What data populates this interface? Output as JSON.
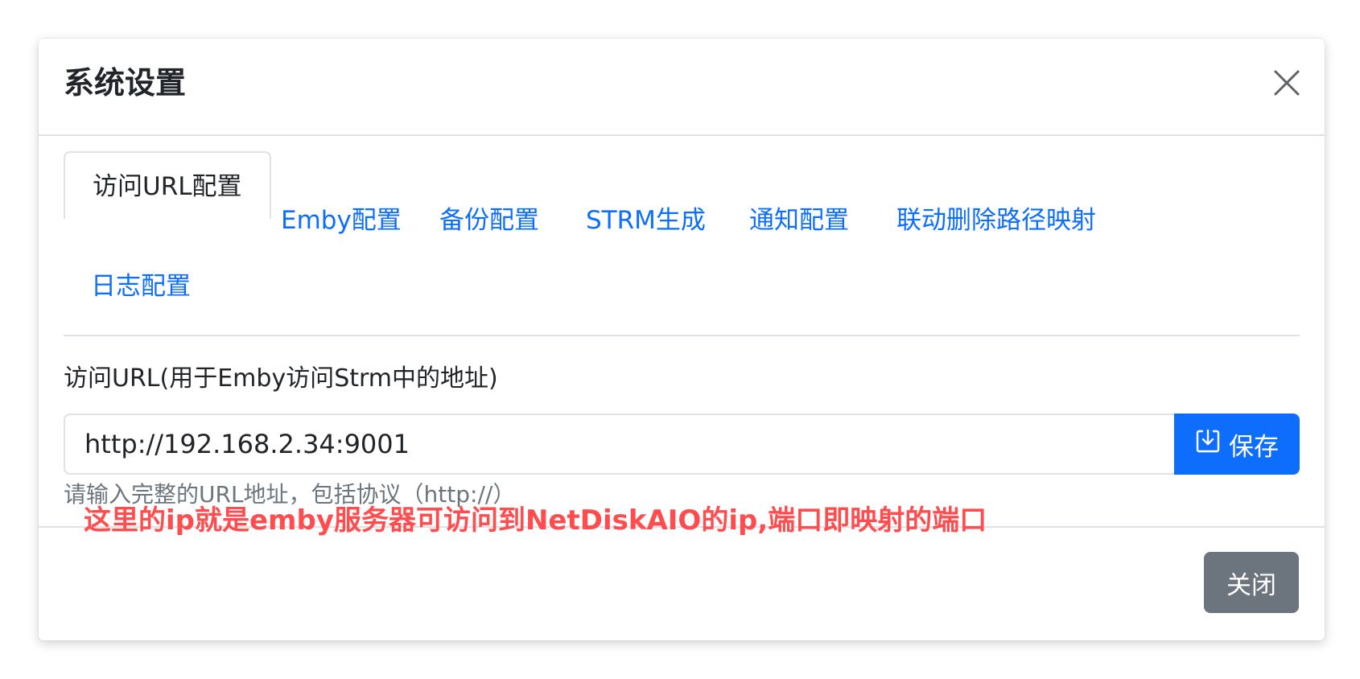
{
  "modal": {
    "title": "系统设置",
    "close_icon": "close-icon"
  },
  "tabs": [
    {
      "label": "访问URL配置",
      "active": true
    },
    {
      "label": "Emby配置",
      "active": false
    },
    {
      "label": "备份配置",
      "active": false
    },
    {
      "label": "STRM生成",
      "active": false
    },
    {
      "label": "通知配置",
      "active": false
    },
    {
      "label": "联动删除路径映射",
      "active": false
    },
    {
      "label": "日志配置",
      "active": false
    }
  ],
  "form": {
    "label": "访问URL(用于Emby访问Strm中的地址)",
    "url_value": "http://192.168.2.34:9001",
    "save_label": "保存",
    "save_icon": "download-icon",
    "help_text": "请输入完整的URL地址，包括协议（http://）"
  },
  "annotation": "这里的ip就是emby服务器可访问到NetDiskAIO的ip,端口即映射的端口",
  "footer": {
    "close_label": "关闭"
  },
  "colors": {
    "primary": "#0d6efd",
    "secondary": "#6c757d",
    "annotation": "#ff4d4f",
    "text": "#212529",
    "border": "#dee2e6"
  }
}
